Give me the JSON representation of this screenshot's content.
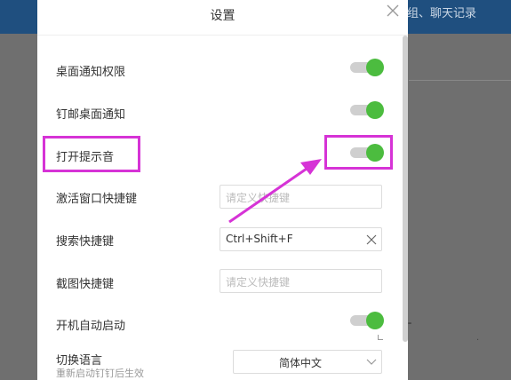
{
  "background": {
    "header_text": "组、聊天记录"
  },
  "dialog": {
    "title": "设置"
  },
  "settings": {
    "desktop_notify_permission": {
      "label": "桌面通知权限",
      "enabled": true
    },
    "dingmail_desktop_notify": {
      "label": "钉邮桌面通知",
      "enabled": true
    },
    "sound": {
      "label": "打开提示音",
      "enabled": true
    },
    "activate_shortcut": {
      "label": "激活窗口快捷键",
      "placeholder": "请定义快捷键"
    },
    "search_shortcut": {
      "label": "搜索快捷键",
      "value": "Ctrl+Shift+F"
    },
    "screenshot_shortcut": {
      "label": "截图快捷键",
      "placeholder": "请定义快捷键"
    },
    "autostart": {
      "label": "开机自动启动",
      "enabled": true
    },
    "language": {
      "label": "切换语言",
      "note": "重新启动钉钉后生效",
      "value": "简体中文"
    }
  },
  "colors": {
    "toggle_on": "#4cbc3f",
    "annotation": "#d633d6",
    "header": "#1f4f7f"
  }
}
